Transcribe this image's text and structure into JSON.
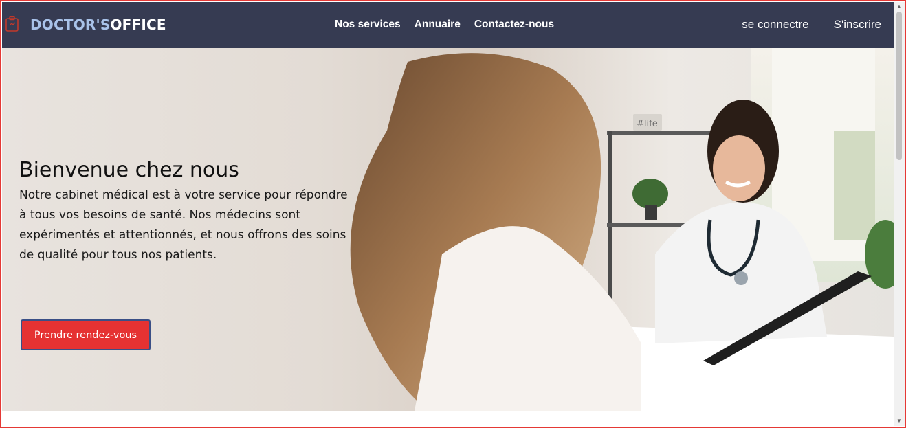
{
  "navbar": {
    "brand_part1": "DOCTOR'S",
    "brand_part2": "OFFICE",
    "links": [
      "Nos services",
      "Annuaire",
      "Contactez-nous"
    ],
    "login": "se connectre",
    "signup": "S'inscrire"
  },
  "hero": {
    "title": "Bienvenue chez nous",
    "description": "Notre cabinet médical est à votre service pour répondre à tous vos besoins de santé. Nos médecins sont expérimentés et attentionnés, et nous offrons des soins de qualité pour tous nos patients.",
    "cta": "Prendre rendez-vous",
    "image_sign": "#life"
  },
  "colors": {
    "navbar_bg": "#363b52",
    "brand_accent": "#a9c3ea",
    "cta_bg": "#e53232",
    "frame": "#e53935"
  },
  "icons": {
    "logo": "medical-clipboard-icon",
    "scroll_up": "scroll-up-arrow-icon",
    "scroll_down": "scroll-down-arrow-icon"
  }
}
